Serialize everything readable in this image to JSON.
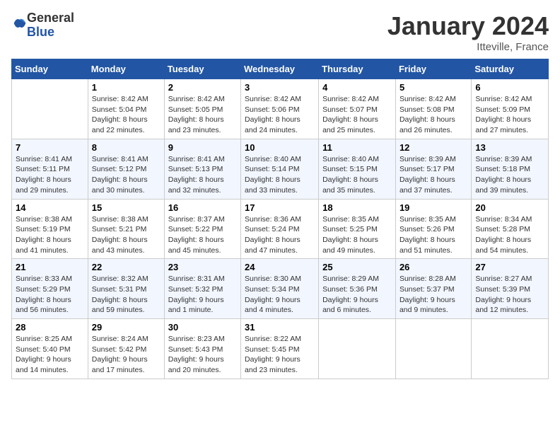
{
  "logo": {
    "general": "General",
    "blue": "Blue"
  },
  "title": "January 2024",
  "subtitle": "Itteville, France",
  "days_header": [
    "Sunday",
    "Monday",
    "Tuesday",
    "Wednesday",
    "Thursday",
    "Friday",
    "Saturday"
  ],
  "weeks": [
    [
      {
        "num": "",
        "sunrise": "",
        "sunset": "",
        "daylight": ""
      },
      {
        "num": "1",
        "sunrise": "Sunrise: 8:42 AM",
        "sunset": "Sunset: 5:04 PM",
        "daylight": "Daylight: 8 hours and 22 minutes."
      },
      {
        "num": "2",
        "sunrise": "Sunrise: 8:42 AM",
        "sunset": "Sunset: 5:05 PM",
        "daylight": "Daylight: 8 hours and 23 minutes."
      },
      {
        "num": "3",
        "sunrise": "Sunrise: 8:42 AM",
        "sunset": "Sunset: 5:06 PM",
        "daylight": "Daylight: 8 hours and 24 minutes."
      },
      {
        "num": "4",
        "sunrise": "Sunrise: 8:42 AM",
        "sunset": "Sunset: 5:07 PM",
        "daylight": "Daylight: 8 hours and 25 minutes."
      },
      {
        "num": "5",
        "sunrise": "Sunrise: 8:42 AM",
        "sunset": "Sunset: 5:08 PM",
        "daylight": "Daylight: 8 hours and 26 minutes."
      },
      {
        "num": "6",
        "sunrise": "Sunrise: 8:42 AM",
        "sunset": "Sunset: 5:09 PM",
        "daylight": "Daylight: 8 hours and 27 minutes."
      }
    ],
    [
      {
        "num": "7",
        "sunrise": "Sunrise: 8:41 AM",
        "sunset": "Sunset: 5:11 PM",
        "daylight": "Daylight: 8 hours and 29 minutes."
      },
      {
        "num": "8",
        "sunrise": "Sunrise: 8:41 AM",
        "sunset": "Sunset: 5:12 PM",
        "daylight": "Daylight: 8 hours and 30 minutes."
      },
      {
        "num": "9",
        "sunrise": "Sunrise: 8:41 AM",
        "sunset": "Sunset: 5:13 PM",
        "daylight": "Daylight: 8 hours and 32 minutes."
      },
      {
        "num": "10",
        "sunrise": "Sunrise: 8:40 AM",
        "sunset": "Sunset: 5:14 PM",
        "daylight": "Daylight: 8 hours and 33 minutes."
      },
      {
        "num": "11",
        "sunrise": "Sunrise: 8:40 AM",
        "sunset": "Sunset: 5:15 PM",
        "daylight": "Daylight: 8 hours and 35 minutes."
      },
      {
        "num": "12",
        "sunrise": "Sunrise: 8:39 AM",
        "sunset": "Sunset: 5:17 PM",
        "daylight": "Daylight: 8 hours and 37 minutes."
      },
      {
        "num": "13",
        "sunrise": "Sunrise: 8:39 AM",
        "sunset": "Sunset: 5:18 PM",
        "daylight": "Daylight: 8 hours and 39 minutes."
      }
    ],
    [
      {
        "num": "14",
        "sunrise": "Sunrise: 8:38 AM",
        "sunset": "Sunset: 5:19 PM",
        "daylight": "Daylight: 8 hours and 41 minutes."
      },
      {
        "num": "15",
        "sunrise": "Sunrise: 8:38 AM",
        "sunset": "Sunset: 5:21 PM",
        "daylight": "Daylight: 8 hours and 43 minutes."
      },
      {
        "num": "16",
        "sunrise": "Sunrise: 8:37 AM",
        "sunset": "Sunset: 5:22 PM",
        "daylight": "Daylight: 8 hours and 45 minutes."
      },
      {
        "num": "17",
        "sunrise": "Sunrise: 8:36 AM",
        "sunset": "Sunset: 5:24 PM",
        "daylight": "Daylight: 8 hours and 47 minutes."
      },
      {
        "num": "18",
        "sunrise": "Sunrise: 8:35 AM",
        "sunset": "Sunset: 5:25 PM",
        "daylight": "Daylight: 8 hours and 49 minutes."
      },
      {
        "num": "19",
        "sunrise": "Sunrise: 8:35 AM",
        "sunset": "Sunset: 5:26 PM",
        "daylight": "Daylight: 8 hours and 51 minutes."
      },
      {
        "num": "20",
        "sunrise": "Sunrise: 8:34 AM",
        "sunset": "Sunset: 5:28 PM",
        "daylight": "Daylight: 8 hours and 54 minutes."
      }
    ],
    [
      {
        "num": "21",
        "sunrise": "Sunrise: 8:33 AM",
        "sunset": "Sunset: 5:29 PM",
        "daylight": "Daylight: 8 hours and 56 minutes."
      },
      {
        "num": "22",
        "sunrise": "Sunrise: 8:32 AM",
        "sunset": "Sunset: 5:31 PM",
        "daylight": "Daylight: 8 hours and 59 minutes."
      },
      {
        "num": "23",
        "sunrise": "Sunrise: 8:31 AM",
        "sunset": "Sunset: 5:32 PM",
        "daylight": "Daylight: 9 hours and 1 minute."
      },
      {
        "num": "24",
        "sunrise": "Sunrise: 8:30 AM",
        "sunset": "Sunset: 5:34 PM",
        "daylight": "Daylight: 9 hours and 4 minutes."
      },
      {
        "num": "25",
        "sunrise": "Sunrise: 8:29 AM",
        "sunset": "Sunset: 5:36 PM",
        "daylight": "Daylight: 9 hours and 6 minutes."
      },
      {
        "num": "26",
        "sunrise": "Sunrise: 8:28 AM",
        "sunset": "Sunset: 5:37 PM",
        "daylight": "Daylight: 9 hours and 9 minutes."
      },
      {
        "num": "27",
        "sunrise": "Sunrise: 8:27 AM",
        "sunset": "Sunset: 5:39 PM",
        "daylight": "Daylight: 9 hours and 12 minutes."
      }
    ],
    [
      {
        "num": "28",
        "sunrise": "Sunrise: 8:25 AM",
        "sunset": "Sunset: 5:40 PM",
        "daylight": "Daylight: 9 hours and 14 minutes."
      },
      {
        "num": "29",
        "sunrise": "Sunrise: 8:24 AM",
        "sunset": "Sunset: 5:42 PM",
        "daylight": "Daylight: 9 hours and 17 minutes."
      },
      {
        "num": "30",
        "sunrise": "Sunrise: 8:23 AM",
        "sunset": "Sunset: 5:43 PM",
        "daylight": "Daylight: 9 hours and 20 minutes."
      },
      {
        "num": "31",
        "sunrise": "Sunrise: 8:22 AM",
        "sunset": "Sunset: 5:45 PM",
        "daylight": "Daylight: 9 hours and 23 minutes."
      },
      {
        "num": "",
        "sunrise": "",
        "sunset": "",
        "daylight": ""
      },
      {
        "num": "",
        "sunrise": "",
        "sunset": "",
        "daylight": ""
      },
      {
        "num": "",
        "sunrise": "",
        "sunset": "",
        "daylight": ""
      }
    ]
  ]
}
